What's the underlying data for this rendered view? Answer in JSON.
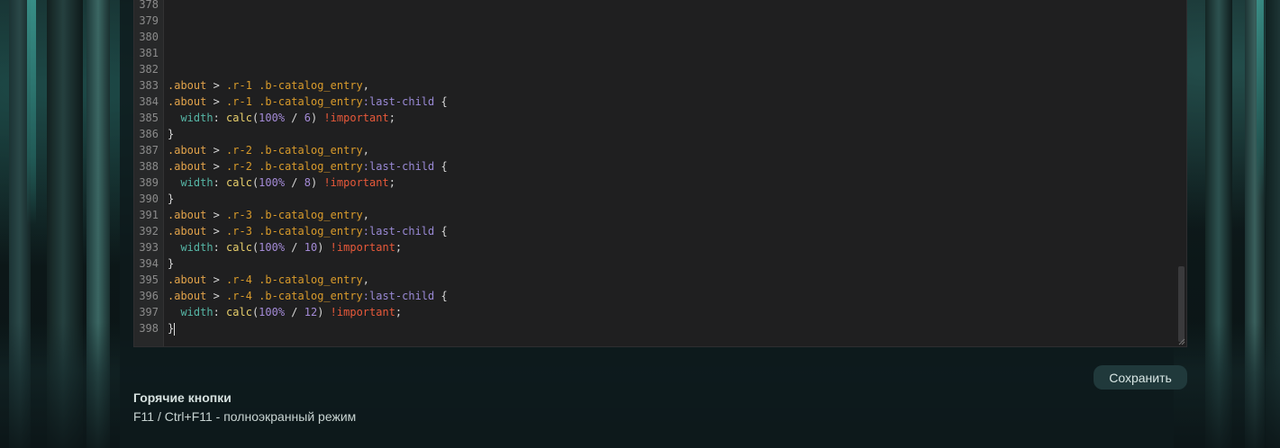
{
  "editor": {
    "lines": [
      {
        "n": "378",
        "tokens": []
      },
      {
        "n": "379",
        "tokens": []
      },
      {
        "n": "380",
        "tokens": []
      },
      {
        "n": "381",
        "tokens": []
      },
      {
        "n": "382",
        "tokens": []
      },
      {
        "n": "383",
        "tokens": [
          [
            "sel",
            ".about"
          ],
          [
            "punc",
            " > "
          ],
          [
            "cls",
            ".r-1"
          ],
          [
            "punc",
            " "
          ],
          [
            "cls",
            ".b-catalog_entry"
          ],
          [
            "punc",
            ","
          ]
        ]
      },
      {
        "n": "384",
        "tokens": [
          [
            "sel",
            ".about"
          ],
          [
            "punc",
            " > "
          ],
          [
            "cls",
            ".r-1"
          ],
          [
            "punc",
            " "
          ],
          [
            "cls",
            ".b-catalog_entry"
          ],
          [
            "pseudo",
            ":last-child"
          ],
          [
            "punc",
            " {"
          ]
        ]
      },
      {
        "n": "385",
        "tokens": [
          [
            "punc",
            "  "
          ],
          [
            "prop",
            "width"
          ],
          [
            "punc",
            ": "
          ],
          [
            "fn",
            "calc"
          ],
          [
            "punc",
            "("
          ],
          [
            "num",
            "100%"
          ],
          [
            "punc",
            " / "
          ],
          [
            "num",
            "6"
          ],
          [
            "punc",
            ") "
          ],
          [
            "imp",
            "!important"
          ],
          [
            "punc",
            ";"
          ]
        ]
      },
      {
        "n": "386",
        "tokens": [
          [
            "punc",
            "}"
          ]
        ]
      },
      {
        "n": "387",
        "tokens": [
          [
            "sel",
            ".about"
          ],
          [
            "punc",
            " > "
          ],
          [
            "cls",
            ".r-2"
          ],
          [
            "punc",
            " "
          ],
          [
            "cls",
            ".b-catalog_entry"
          ],
          [
            "punc",
            ","
          ]
        ]
      },
      {
        "n": "388",
        "tokens": [
          [
            "sel",
            ".about"
          ],
          [
            "punc",
            " > "
          ],
          [
            "cls",
            ".r-2"
          ],
          [
            "punc",
            " "
          ],
          [
            "cls",
            ".b-catalog_entry"
          ],
          [
            "pseudo",
            ":last-child"
          ],
          [
            "punc",
            " {"
          ]
        ]
      },
      {
        "n": "389",
        "tokens": [
          [
            "punc",
            "  "
          ],
          [
            "prop",
            "width"
          ],
          [
            "punc",
            ": "
          ],
          [
            "fn",
            "calc"
          ],
          [
            "punc",
            "("
          ],
          [
            "num",
            "100%"
          ],
          [
            "punc",
            " / "
          ],
          [
            "num",
            "8"
          ],
          [
            "punc",
            ") "
          ],
          [
            "imp",
            "!important"
          ],
          [
            "punc",
            ";"
          ]
        ]
      },
      {
        "n": "390",
        "tokens": [
          [
            "punc",
            "}"
          ]
        ]
      },
      {
        "n": "391",
        "tokens": [
          [
            "sel",
            ".about"
          ],
          [
            "punc",
            " > "
          ],
          [
            "cls",
            ".r-3"
          ],
          [
            "punc",
            " "
          ],
          [
            "cls",
            ".b-catalog_entry"
          ],
          [
            "punc",
            ","
          ]
        ]
      },
      {
        "n": "392",
        "tokens": [
          [
            "sel",
            ".about"
          ],
          [
            "punc",
            " > "
          ],
          [
            "cls",
            ".r-3"
          ],
          [
            "punc",
            " "
          ],
          [
            "cls",
            ".b-catalog_entry"
          ],
          [
            "pseudo",
            ":last-child"
          ],
          [
            "punc",
            " {"
          ]
        ]
      },
      {
        "n": "393",
        "tokens": [
          [
            "punc",
            "  "
          ],
          [
            "prop",
            "width"
          ],
          [
            "punc",
            ": "
          ],
          [
            "fn",
            "calc"
          ],
          [
            "punc",
            "("
          ],
          [
            "num",
            "100%"
          ],
          [
            "punc",
            " / "
          ],
          [
            "num",
            "10"
          ],
          [
            "punc",
            ") "
          ],
          [
            "imp",
            "!important"
          ],
          [
            "punc",
            ";"
          ]
        ]
      },
      {
        "n": "394",
        "tokens": [
          [
            "punc",
            "}"
          ]
        ]
      },
      {
        "n": "395",
        "tokens": [
          [
            "sel",
            ".about"
          ],
          [
            "punc",
            " > "
          ],
          [
            "cls",
            ".r-4"
          ],
          [
            "punc",
            " "
          ],
          [
            "cls",
            ".b-catalog_entry"
          ],
          [
            "punc",
            ","
          ]
        ]
      },
      {
        "n": "396",
        "tokens": [
          [
            "sel",
            ".about"
          ],
          [
            "punc",
            " > "
          ],
          [
            "cls",
            ".r-4"
          ],
          [
            "punc",
            " "
          ],
          [
            "cls",
            ".b-catalog_entry"
          ],
          [
            "pseudo",
            ":last-child"
          ],
          [
            "punc",
            " {"
          ]
        ]
      },
      {
        "n": "397",
        "tokens": [
          [
            "punc",
            "  "
          ],
          [
            "prop",
            "width"
          ],
          [
            "punc",
            ": "
          ],
          [
            "fn",
            "calc"
          ],
          [
            "punc",
            "("
          ],
          [
            "num",
            "100%"
          ],
          [
            "punc",
            " / "
          ],
          [
            "num",
            "12"
          ],
          [
            "punc",
            ") "
          ],
          [
            "imp",
            "!important"
          ],
          [
            "punc",
            ";"
          ]
        ]
      },
      {
        "n": "398",
        "tokens": [
          [
            "punc",
            "}"
          ]
        ],
        "caret": true
      }
    ]
  },
  "actions": {
    "save_label": "Сохранить"
  },
  "hotkeys": {
    "title": "Горячие кнопки",
    "items": [
      "F11 / Ctrl+F11 - полноэкранный режим"
    ]
  }
}
